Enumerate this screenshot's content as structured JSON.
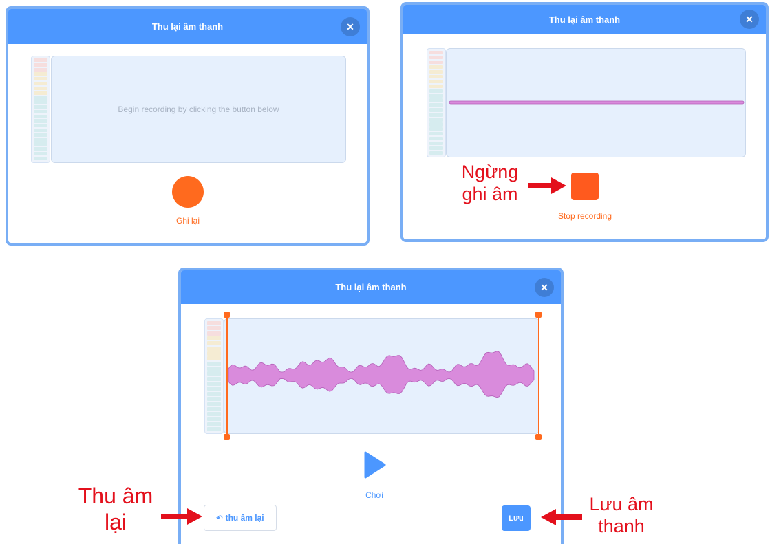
{
  "dialog_title": "Thu lại âm thanh",
  "close_icon": "close-icon",
  "panel1": {
    "hint": "Begin recording by clicking the button below",
    "record_label": "Ghi lại"
  },
  "panel2": {
    "stop_label": "Stop recording",
    "annotation_line1": "Ngừng",
    "annotation_line2": "ghi âm"
  },
  "panel3": {
    "play_label": "Chơi",
    "rerecord_label": "thu âm lại",
    "save_label": "Lưu",
    "annotation_left_line1": "Thu âm",
    "annotation_left_line2": "lại",
    "annotation_right_line1": "Lưu âm",
    "annotation_right_line2": "thanh"
  },
  "colors": {
    "header": "#4c97ff",
    "record": "#ff6a1e",
    "waveform": "#d98bdc",
    "annotation": "#e3101c"
  }
}
